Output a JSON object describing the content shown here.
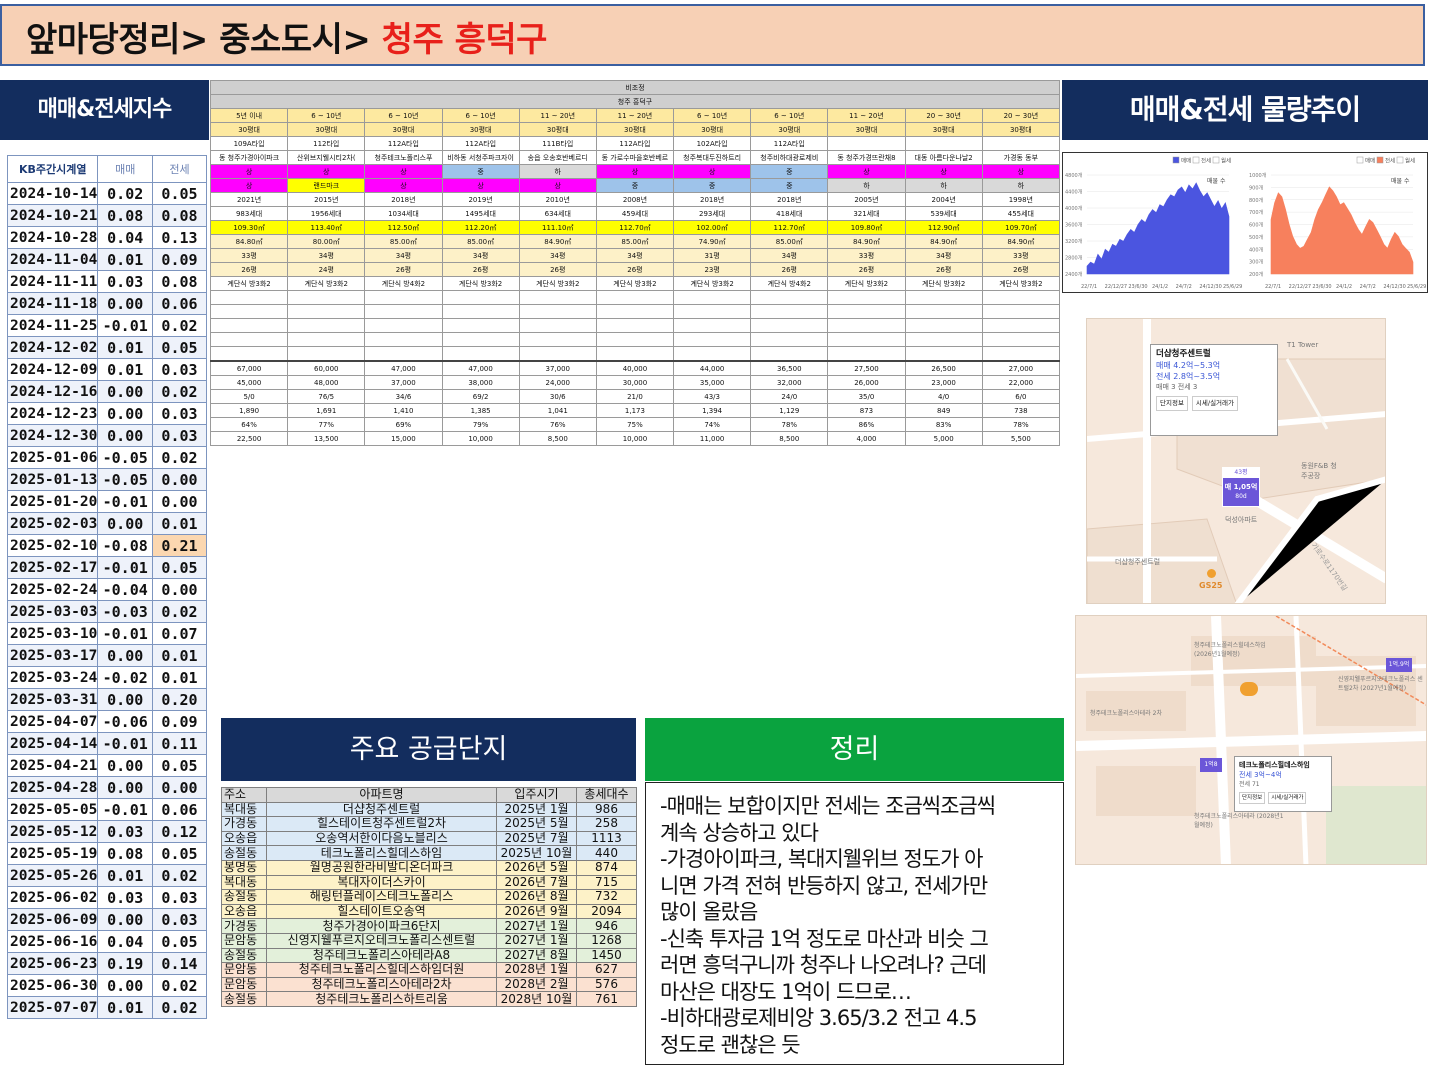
{
  "header": {
    "path_prefix": "앞마당정리> 중소도시> ",
    "city": "청주 흥덕구"
  },
  "kb_section": {
    "title": "매매&전세지수",
    "col_date": "KB주간시계열",
    "col_sale": "매매",
    "col_rent": "전세",
    "rows": [
      [
        "2024-10-14",
        "0.02",
        "0.05"
      ],
      [
        "2024-10-21",
        "0.08",
        "0.08"
      ],
      [
        "2024-10-28",
        "0.04",
        "0.13"
      ],
      [
        "2024-11-04",
        "0.01",
        "0.09"
      ],
      [
        "2024-11-11",
        "0.03",
        "0.08"
      ],
      [
        "2024-11-18",
        "0.00",
        "0.06"
      ],
      [
        "2024-11-25",
        "-0.01",
        "0.02"
      ],
      [
        "2024-12-02",
        "0.01",
        "0.05"
      ],
      [
        "2024-12-09",
        "0.01",
        "0.03"
      ],
      [
        "2024-12-16",
        "0.00",
        "0.02"
      ],
      [
        "2024-12-23",
        "0.00",
        "0.03"
      ],
      [
        "2024-12-30",
        "0.00",
        "0.03"
      ],
      [
        "2025-01-06",
        "-0.05",
        "0.02"
      ],
      [
        "2025-01-13",
        "-0.05",
        "0.00"
      ],
      [
        "2025-01-20",
        "-0.01",
        "0.00"
      ],
      [
        "2025-02-03",
        "0.00",
        "0.01"
      ],
      [
        "2025-02-10",
        "-0.08",
        "0.21"
      ],
      [
        "2025-02-17",
        "-0.01",
        "0.05"
      ],
      [
        "2025-02-24",
        "-0.04",
        "0.00"
      ],
      [
        "2025-03-03",
        "-0.03",
        "0.02"
      ],
      [
        "2025-03-10",
        "-0.01",
        "0.07"
      ],
      [
        "2025-03-17",
        "0.00",
        "0.01"
      ],
      [
        "2025-03-24",
        "-0.02",
        "0.01"
      ],
      [
        "2025-03-31",
        "0.00",
        "0.20"
      ],
      [
        "2025-04-07",
        "-0.06",
        "0.09"
      ],
      [
        "2025-04-14",
        "-0.01",
        "0.11"
      ],
      [
        "2025-04-21",
        "0.00",
        "0.05"
      ],
      [
        "2025-04-28",
        "0.00",
        "0.00"
      ],
      [
        "2025-05-05",
        "-0.01",
        "0.06"
      ],
      [
        "2025-05-12",
        "0.03",
        "0.12"
      ],
      [
        "2025-05-19",
        "0.08",
        "0.05"
      ],
      [
        "2025-05-26",
        "0.01",
        "0.02"
      ],
      [
        "2025-06-02",
        "0.03",
        "0.03"
      ],
      [
        "2025-06-09",
        "0.00",
        "0.03"
      ],
      [
        "2025-06-16",
        "0.04",
        "0.05"
      ],
      [
        "2025-06-23",
        "0.19",
        "0.14"
      ],
      [
        "2025-06-30",
        "0.00",
        "0.02"
      ],
      [
        "2025-07-07",
        "0.01",
        "0.02"
      ]
    ],
    "highlight_color": "#fbd7b0"
  },
  "comparison": {
    "title_row1": "비조정",
    "title_row2": "청주 흥덕구",
    "columns": [
      {
        "age": "5년 이내",
        "size": "30평대",
        "type": "109A타입",
        "name": "동 청주가경아이파크",
        "grade": "상",
        "grade2": "상",
        "year": "2021년",
        "households": "983세대",
        "area": "109.30㎡",
        "exclusive": "84.80㎡",
        "py": "33평",
        "py2": "26평",
        "structure": "계단식 방3화2",
        "r1": "67,000",
        "r2": "45,000",
        "r3": "5/0",
        "r4": "1,890",
        "r5": "64%",
        "r6": "22,500",
        "c1": "mag",
        "c2": "mag"
      },
      {
        "age": "6 ~ 10년",
        "size": "30평대",
        "type": "112타입",
        "name": "산위브지웰시티2차(",
        "grade": "상",
        "grade2": "랜드마크",
        "year": "2015년",
        "households": "1956세대",
        "area": "113.40㎡",
        "exclusive": "80.00㎡",
        "py": "34평",
        "py2": "24평",
        "structure": "계단식 방3화2",
        "r1": "60,000",
        "r2": "48,000",
        "r3": "76/5",
        "r4": "1,691",
        "r5": "77%",
        "r6": "13,500",
        "c1": "mag",
        "c2": "ylw"
      },
      {
        "age": "6 ~ 10년",
        "size": "30평대",
        "type": "112A타입",
        "name": "청주테크노폴리스푸",
        "grade": "상",
        "grade2": "상",
        "year": "2018년",
        "households": "1034세대",
        "area": "112.50㎡",
        "exclusive": "85.00㎡",
        "py": "34평",
        "py2": "26평",
        "structure": "계단식 방4화2",
        "r1": "47,000",
        "r2": "37,000",
        "r3": "34/6",
        "r4": "1,410",
        "r5": "69%",
        "r6": "15,000",
        "c1": "mag",
        "c2": "mag"
      },
      {
        "age": "6 ~ 10년",
        "size": "30평대",
        "type": "112A타입",
        "name": "비하동 서청주파크자이",
        "grade": "중",
        "grade2": "상",
        "year": "2019년",
        "households": "1495세대",
        "area": "112.20㎡",
        "exclusive": "85.00㎡",
        "py": "34평",
        "py2": "26평",
        "structure": "계단식 방3화2",
        "r1": "47,000",
        "r2": "38,000",
        "r3": "69/2",
        "r4": "1,385",
        "r5": "79%",
        "r6": "10,000",
        "c1": "lb",
        "c2": "mag"
      },
      {
        "age": "11 ~ 20년",
        "size": "30평대",
        "type": "111B타입",
        "name": "송읍 오송호반베르디",
        "grade": "하",
        "grade2": "상",
        "year": "2010년",
        "households": "634세대",
        "area": "111.10㎡",
        "exclusive": "84.90㎡",
        "py": "34평",
        "py2": "26평",
        "structure": "계단식 방3화2",
        "r1": "37,000",
        "r2": "24,000",
        "r3": "30/6",
        "r4": "1,041",
        "r5": "76%",
        "r6": "8,500",
        "c1": "gry",
        "c2": "mag"
      },
      {
        "age": "11 ~ 20년",
        "size": "30평대",
        "type": "112A타입",
        "name": "동 가로수마을호반베르",
        "grade": "상",
        "grade2": "중",
        "year": "2008년",
        "households": "459세대",
        "area": "112.70㎡",
        "exclusive": "85.00㎡",
        "py": "34평",
        "py2": "26평",
        "structure": "계단식 방3화2",
        "r1": "40,000",
        "r2": "30,000",
        "r3": "21/0",
        "r4": "1,173",
        "r5": "75%",
        "r6": "10,000",
        "c1": "mag",
        "c2": "lb"
      },
      {
        "age": "6 ~ 10년",
        "size": "30평대",
        "type": "102A타입",
        "name": "청주복대두진하트리",
        "grade": "상",
        "grade2": "중",
        "year": "2018년",
        "households": "293세대",
        "area": "102.00㎡",
        "exclusive": "74.90㎡",
        "py": "31평",
        "py2": "23평",
        "structure": "계단식 방3화2",
        "r1": "44,000",
        "r2": "35,000",
        "r3": "43/3",
        "r4": "1,394",
        "r5": "74%",
        "r6": "11,000",
        "c1": "mag",
        "c2": "lb"
      },
      {
        "age": "6 ~ 10년",
        "size": "30평대",
        "type": "112A타입",
        "name": "청주비하대광로제비",
        "grade": "중",
        "grade2": "중",
        "year": "2018년",
        "households": "418세대",
        "area": "112.70㎡",
        "exclusive": "85.00㎡",
        "py": "34평",
        "py2": "26평",
        "structure": "계단식 방4화2",
        "r1": "36,500",
        "r2": "32,000",
        "r3": "24/0",
        "r4": "1,129",
        "r5": "78%",
        "r6": "8,500",
        "c1": "lb",
        "c2": "lb"
      },
      {
        "age": "11 ~ 20년",
        "size": "30평대",
        "type": "",
        "name": "동 청주가경뜨란채8",
        "grade": "상",
        "grade2": "하",
        "year": "2005년",
        "households": "321세대",
        "area": "109.80㎡",
        "exclusive": "84.90㎡",
        "py": "33평",
        "py2": "26평",
        "structure": "계단식 방3화2",
        "r1": "27,500",
        "r2": "26,000",
        "r3": "35/0",
        "r4": "873",
        "r5": "86%",
        "r6": "4,000",
        "c1": "mag",
        "c2": "gry"
      },
      {
        "age": "20 ~ 30년",
        "size": "30평대",
        "type": "",
        "name": "대동 아름다운나날2",
        "grade": "상",
        "grade2": "하",
        "year": "2004년",
        "households": "539세대",
        "area": "112.90㎡",
        "exclusive": "84.90㎡",
        "py": "34평",
        "py2": "26평",
        "structure": "계단식 방3화2",
        "r1": "26,500",
        "r2": "23,000",
        "r3": "4/0",
        "r4": "849",
        "r5": "83%",
        "r6": "5,000",
        "c1": "mag",
        "c2": "gry"
      },
      {
        "age": "20 ~ 30년",
        "size": "30평대",
        "type": "",
        "name": "가경동 동부",
        "grade": "상",
        "grade2": "하",
        "year": "1998년",
        "households": "455세대",
        "area": "109.70㎡",
        "exclusive": "84.90㎡",
        "py": "33평",
        "py2": "26평",
        "structure": "계단식 방3화2",
        "r1": "27,000",
        "r2": "22,000",
        "r3": "6/0",
        "r4": "738",
        "r5": "78%",
        "r6": "5,500",
        "c1": "mag",
        "c2": "gry"
      }
    ]
  },
  "volume_section": {
    "title": "매매&전세 물량추이",
    "left_legend": [
      "매매",
      "전세",
      "월세"
    ],
    "right_legend": [
      "매매",
      "전세",
      "월세"
    ],
    "left_label": "매물 수",
    "right_label": "매물 수",
    "x_labels": [
      "22/7/1",
      "22/12/27",
      "23/6/30",
      "24/1/2",
      "24/7/2",
      "24/12/30",
      "25/6/29"
    ],
    "left_y_labels": [
      "4800개",
      "4400개",
      "4000개",
      "3600개",
      "3200개",
      "2800개",
      "2400개"
    ],
    "right_y_labels": [
      "1000개",
      "900개",
      "800개",
      "700개",
      "600개",
      "500개",
      "400개",
      "300개",
      "200개"
    ],
    "sale_color": "#4b55e0",
    "rent_color": "#f7805d",
    "sale_series": [
      0.08,
      0.12,
      0.1,
      0.2,
      0.15,
      0.25,
      0.22,
      0.3,
      0.28,
      0.35,
      0.33,
      0.4,
      0.45,
      0.42,
      0.5,
      0.55,
      0.52,
      0.6,
      0.65,
      0.62,
      0.7,
      0.68,
      0.75,
      0.8,
      0.78,
      0.85,
      0.88,
      0.82,
      0.9,
      0.86,
      0.92,
      0.84,
      0.78,
      0.82,
      0.75,
      0.68,
      0.74,
      0.66,
      0.72,
      0.58
    ],
    "rent_series": [
      0.55,
      0.72,
      0.82,
      0.78,
      0.65,
      0.5,
      0.38,
      0.3,
      0.26,
      0.28,
      0.35,
      0.42,
      0.55,
      0.65,
      0.72,
      0.8,
      0.88,
      0.84,
      0.78,
      0.7,
      0.72,
      0.66,
      0.6,
      0.52,
      0.45,
      0.4,
      0.48,
      0.55,
      0.52,
      0.45,
      0.38,
      0.3,
      0.26,
      0.35,
      0.42,
      0.38,
      0.3,
      0.26,
      0.22,
      0.12
    ]
  },
  "map1": {
    "popup_title": "더샵청주센트럴",
    "popup_sale": "매매 4.2억~5.3억",
    "popup_rent": "전세 2.8억~3.5억",
    "popup_count": "매매 3  전세 3",
    "btn1": "단지정보",
    "btn2": "시세/실거래가",
    "label_tower": "T1 Tower",
    "price_tag_top": "43평",
    "price_tag": "매 1,05억",
    "price_tag_sub": "80d",
    "label_apt": "덕성아파트",
    "label_plant": "동원F&B 청주공장",
    "label_central": "더샵청주센트럴",
    "label_road": "가로수로1170번길",
    "label_gs": "GS25"
  },
  "map2": {
    "popup_title": "테크노폴리스힐데스하임",
    "popup_rent": "전세 3억~4억",
    "popup_count": "전세 71",
    "btn1": "단지정보",
    "btn2": "시세/실거래가",
    "tag1": "1억,9억",
    "tag2": "1억8",
    "label_a": "청주테크노폴리스힐데스하임 (2026년1월예정)",
    "label_b": "청주테크노폴리스아테라 2차",
    "label_c": "신영지웰푸르지오테크노폴리스 센트럴2차 (2027년1월예정)",
    "label_d": "청주테크노폴리스아테라 (2028년1월예정)"
  },
  "supply_section": {
    "title": "주요 공급단지",
    "headers": [
      "주소",
      "아파트명",
      "입주시기",
      "총세대수"
    ],
    "rows": [
      [
        "복대동",
        "더샵청주센트럴",
        "2025년 1월",
        "986",
        "b"
      ],
      [
        "가경동",
        "힐스테이트청주센트럴2차",
        "2025년 5월",
        "258",
        "b"
      ],
      [
        "오송읍",
        "오송역서한이다음노블리스",
        "2025년 7월",
        "1113",
        "b"
      ],
      [
        "송절동",
        "테크노폴리스힐데스하임",
        "2025년 10월",
        "440",
        "b"
      ],
      [
        "봉명동",
        "월명공원한라비발디온더파크",
        "2026년 5월",
        "874",
        "y"
      ],
      [
        "복대동",
        "복대자이더스카이",
        "2026년 7월",
        "715",
        "y"
      ],
      [
        "송절동",
        "해링턴플레이스테크노폴리스",
        "2026년 8월",
        "732",
        "y"
      ],
      [
        "오송읍",
        "힐스테이트오송역",
        "2026년 9월",
        "2094",
        "y"
      ],
      [
        "가경동",
        "청주가경아이파크6단지",
        "2027년 1월",
        "946",
        "g"
      ],
      [
        "문암동",
        "신영지웰푸르지오테크노폴리스센트럴",
        "2027년 1월",
        "1268",
        "g"
      ],
      [
        "송절동",
        "청주테크노폴리스아테라A8",
        "2027년 8월",
        "1450",
        "g"
      ],
      [
        "문암동",
        "청주테크노폴리스힐데스하임더원",
        "2028년 1월",
        "627",
        "p"
      ],
      [
        "문암동",
        "청주테크노폴리스아테라2차",
        "2028년 2월",
        "576",
        "p"
      ],
      [
        "송절동",
        "청주테크노폴리스하트리움",
        "2028년 10월",
        "761",
        "p"
      ]
    ]
  },
  "summary_section": {
    "title": "정리",
    "lines": [
      "-매매는 보합이지만 전세는 조금씩조금씩",
      "계속 상승하고 있다",
      "-가경아이파크, 복대지웰위브 정도가 아",
      "니면 가격 전혀 반등하지 않고, 전세가만",
      "많이 올랐음",
      "-신축 투자금 1억 정도로 마산과 비슷 그",
      "러면 흥덕구니까 청주나 나오려나? 근데",
      "마산은 대장도 1억이 드므로…",
      "-비하대광로제비앙 3.65/3.2 전고 4.5",
      "정도로 괜찮은 듯"
    ]
  }
}
